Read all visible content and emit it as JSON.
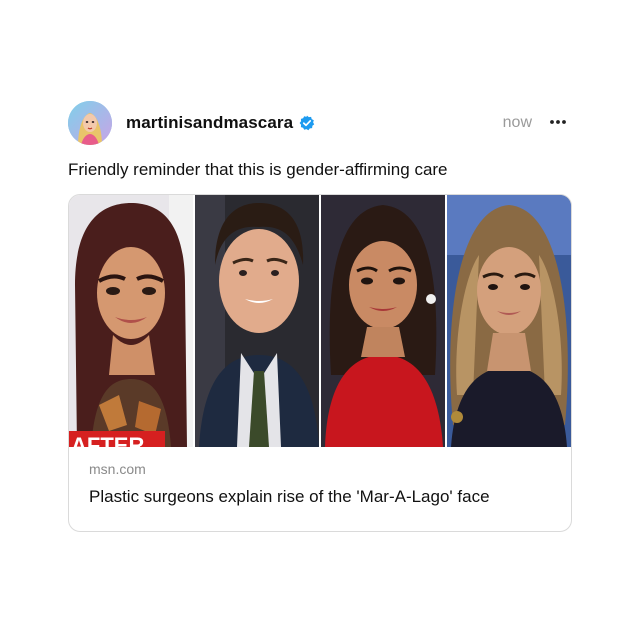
{
  "post": {
    "username": "martinisandmascara",
    "time": "now",
    "caption": "Friendly reminder that this is gender-affirming care",
    "link_card": {
      "domain": "msn.com",
      "headline": "Plastic surgeons explain rise of the 'Mar-A-Lago' face",
      "image_banner_text": "AFTER"
    }
  },
  "icons": {
    "verified": "verified-badge-icon",
    "more": "more-options-icon"
  },
  "colors": {
    "verified_blue": "#1d9bf0",
    "muted_text": "#9a9a9a",
    "card_border": "#dadada"
  }
}
